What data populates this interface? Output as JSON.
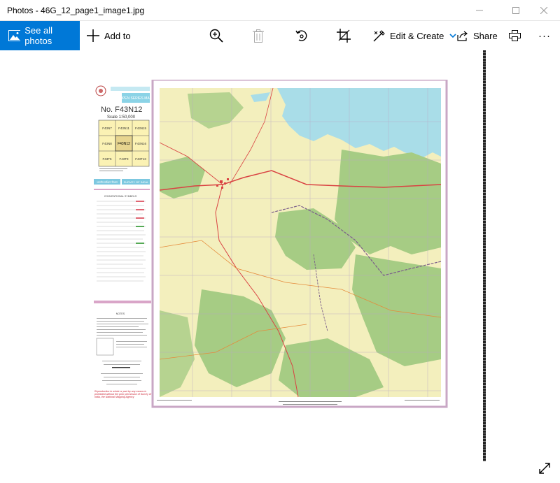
{
  "window": {
    "title": "Photos - 46G_12_page1_image1.jpg",
    "controls": [
      "minimize",
      "maximize",
      "close"
    ]
  },
  "toolbar": {
    "see_all_label": "See all photos",
    "add_to_label": "Add to",
    "edit_create_label": "Edit & Create",
    "share_label": "Share",
    "more_label": "···",
    "accent": "#0078d7"
  },
  "map": {
    "sheet_label": "OPEN SERIES MAP",
    "sheet_number": "No. F43N12",
    "scale": "Scale 1:50,000",
    "grid_rows": [
      [
        "F43N7",
        "F43N11",
        "F43N15"
      ],
      [
        "F43N8",
        "F43N12",
        "F43N16"
      ],
      [
        "F43T5",
        "F43T9",
        "F43T13"
      ]
    ],
    "org_left": "भारतीय सर्वेक्षण विभाग",
    "org_right": "SURVEY OF INDIA",
    "legend_title": "CONVENTIONAL SYMBOLS",
    "notes_title": "NOTES",
    "reproduction_warning": "Reproduction in whole or part by any means is prohibited without the prior permission of Survey of India, the National Mapping Agency",
    "colors": {
      "water": "#a9dde8",
      "forest": "#a6cc84",
      "land": "#f3efbd",
      "road": "#d94242",
      "boundary": "#7a5c8a"
    }
  }
}
